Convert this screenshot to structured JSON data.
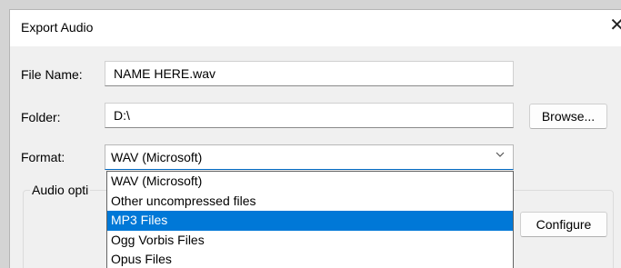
{
  "window": {
    "title": "Export Audio",
    "close_glyph": "✕"
  },
  "file_name": {
    "label": "File Name:",
    "value": "NAME HERE.wav"
  },
  "folder": {
    "label": "Folder:",
    "value": "D:\\",
    "browse_label": "Browse..."
  },
  "format": {
    "label": "Format:",
    "selected": "WAV (Microsoft)",
    "chevron_glyph": "⌵",
    "options": [
      "WAV (Microsoft)",
      "Other uncompressed files",
      "MP3 Files",
      "Ogg Vorbis Files",
      "Opus Files"
    ],
    "highlighted_option": "MP3 Files"
  },
  "audio_options": {
    "label": "Audio opti",
    "configure_label": "Configure"
  },
  "colors": {
    "selection": "#0078d7",
    "dialog_bg": "#f0f0f0"
  }
}
